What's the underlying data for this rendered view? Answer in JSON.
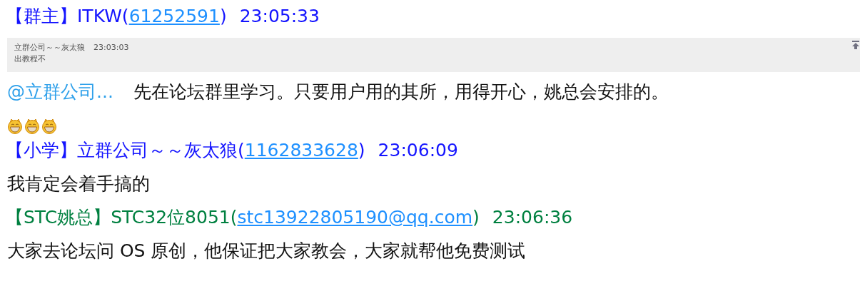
{
  "messages": [
    {
      "sender_prefix": "【群主】ITKW(",
      "sender_id": "61252591",
      "sender_suffix": ")",
      "time": "23:05:33",
      "color": "#1414ff",
      "quote": {
        "author": "立群公司～～灰太狼",
        "time": "23:03:03",
        "text": "出教程不"
      },
      "mention": "@立群公司...",
      "body": "先在论坛群里学习。只要用户用的其所，用得开心，姚总会安排的。",
      "emojis": [
        {
          "kind": "grin"
        },
        {
          "kind": "grin"
        },
        {
          "kind": "grin"
        }
      ]
    },
    {
      "sender_prefix": "【小学】立群公司～～灰太狼(",
      "sender_id": "1162833628",
      "sender_suffix": ")",
      "time": "23:06:09",
      "color": "#1414ff",
      "body": "我肯定会着手搞的"
    },
    {
      "sender_prefix": "【STC姚总】STC32位8051(",
      "sender_id": "stc13922805190@qq.com",
      "sender_suffix": ")",
      "time": "23:06:36",
      "color": "#008040",
      "body": "大家去论坛问 OS 原创，他保证把大家教会，大家就帮他免费测试"
    }
  ]
}
